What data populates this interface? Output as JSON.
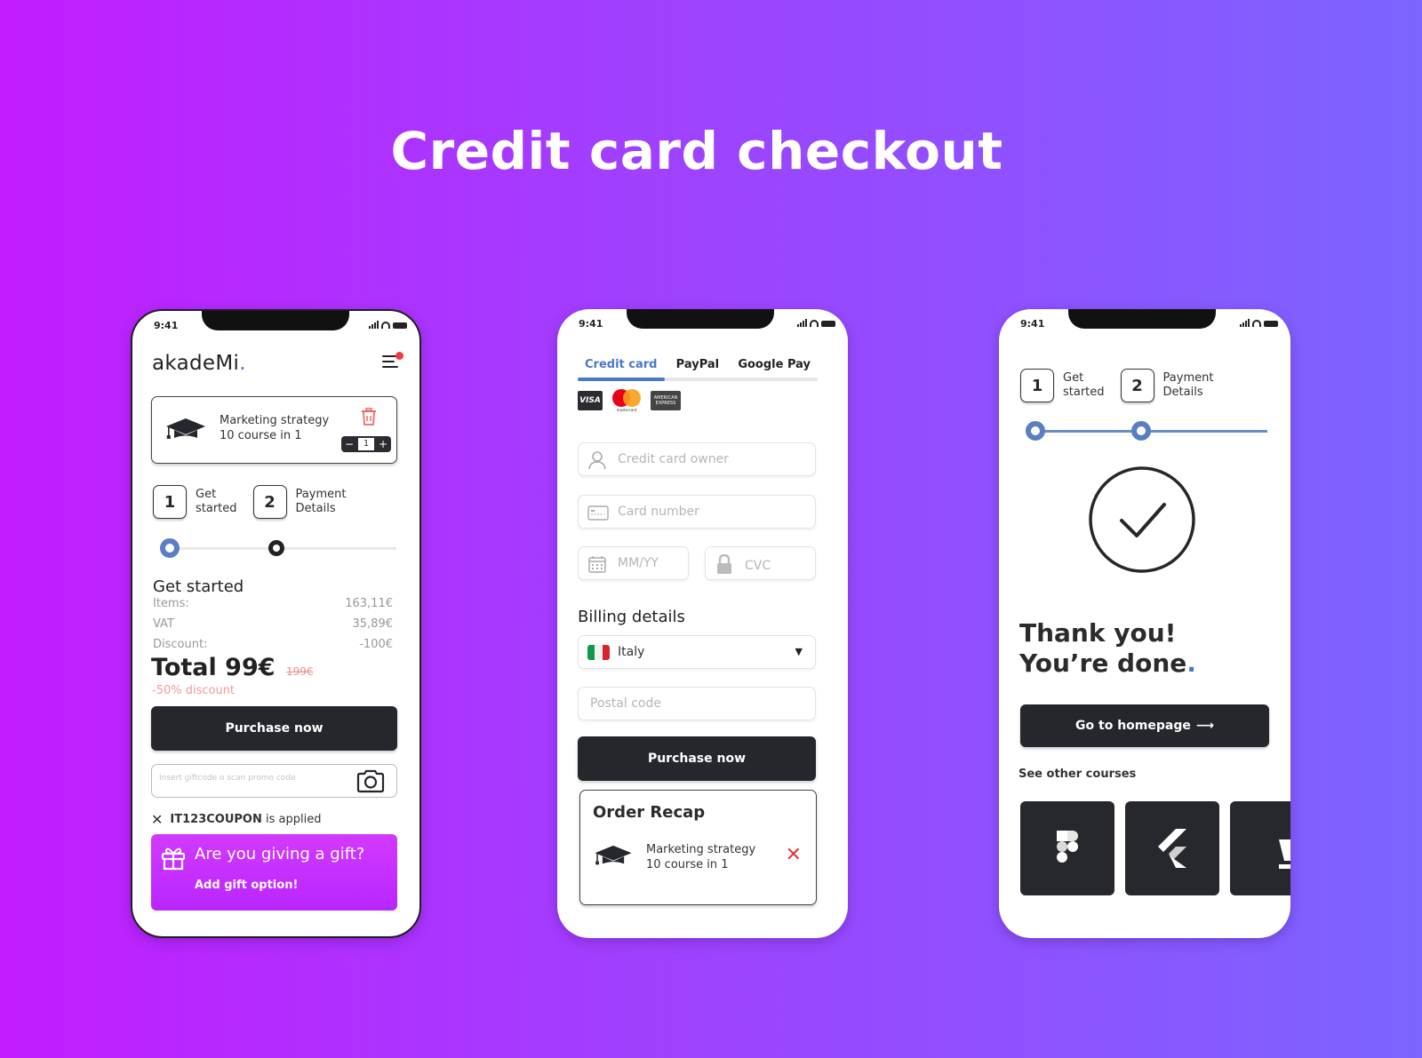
{
  "page": {
    "title": "Credit card checkout"
  },
  "colors": {
    "background_gradient": [
      "#c21cff",
      "#7c64ff"
    ],
    "accent": "#4a78c8",
    "dark": "#26272c",
    "danger": "#e53935",
    "gift_gradient": [
      "#d33aff",
      "#b826ff"
    ]
  },
  "status_bar": {
    "time": "9:41"
  },
  "screen1": {
    "logo": {
      "text": "akadeMi",
      "dot": "."
    },
    "cart_item": {
      "title": "Marketing strategy",
      "subtitle": "10 course in 1",
      "quantity": "1",
      "minus": "−",
      "plus": "+"
    },
    "steps": [
      {
        "number": "1",
        "label_line1": "Get",
        "label_line2": "started"
      },
      {
        "number": "2",
        "label_line1": "Payment",
        "label_line2": "Details"
      }
    ],
    "progress_step": 1,
    "summary": {
      "title": "Get started",
      "rows": [
        {
          "label": "Items:",
          "value": "163,11€"
        },
        {
          "label": "VAT",
          "value": "35,89€"
        },
        {
          "label": "Discount:",
          "value": "-100€"
        }
      ],
      "total": "Total 99€",
      "old_price": "199€",
      "discount_note": "-50% discount"
    },
    "purchase_button": "Purchase now",
    "promo": {
      "placeholder": "Insert giftcode o scan promo code",
      "value": ""
    },
    "coupon": {
      "code": "IT123COUPON",
      "suffix": " is applied"
    },
    "gift": {
      "title": "Are you giving a gift?",
      "link": "Add gift option!"
    }
  },
  "screen2": {
    "tabs": [
      {
        "label": "Credit card",
        "active": true
      },
      {
        "label": "PayPal",
        "active": false
      },
      {
        "label": "Google Pay",
        "active": false
      }
    ],
    "card_brands": {
      "visa": "VISA",
      "mastercard": "mastercard",
      "amex_line1": "AMERICAN",
      "amex_line2": "EXPRESS"
    },
    "fields": {
      "owner": {
        "placeholder": "Credit card owner",
        "value": ""
      },
      "number": {
        "placeholder": "Card number",
        "value": ""
      },
      "expiry": {
        "placeholder": "MM/YY",
        "value": ""
      },
      "cvc": {
        "placeholder": "CVC",
        "value": ""
      }
    },
    "billing_title": "Billing details",
    "country": {
      "selected": "Italy",
      "arrow": "▼"
    },
    "postal": {
      "placeholder": "Postal code",
      "value": ""
    },
    "purchase_button": "Purchase now",
    "recap": {
      "title": "Order Recap",
      "item_title": "Marketing strategy",
      "item_subtitle": "10 course in 1",
      "remove": "✕"
    }
  },
  "screen3": {
    "steps": [
      {
        "number": "1",
        "label_line1": "Get",
        "label_line2": "started"
      },
      {
        "number": "2",
        "label_line1": "Payment",
        "label_line2": "Details"
      }
    ],
    "progress_step": 2,
    "thanks_line1": "Thank you!",
    "thanks_line2": "You’re done",
    "thanks_dot": ".",
    "home_button": "Go to homepage",
    "home_arrow": "⟶",
    "see_other": "See other courses",
    "courses": [
      {
        "icon": "figma-icon"
      },
      {
        "icon": "flutter-icon"
      },
      {
        "icon": "chess-king-icon"
      }
    ]
  }
}
